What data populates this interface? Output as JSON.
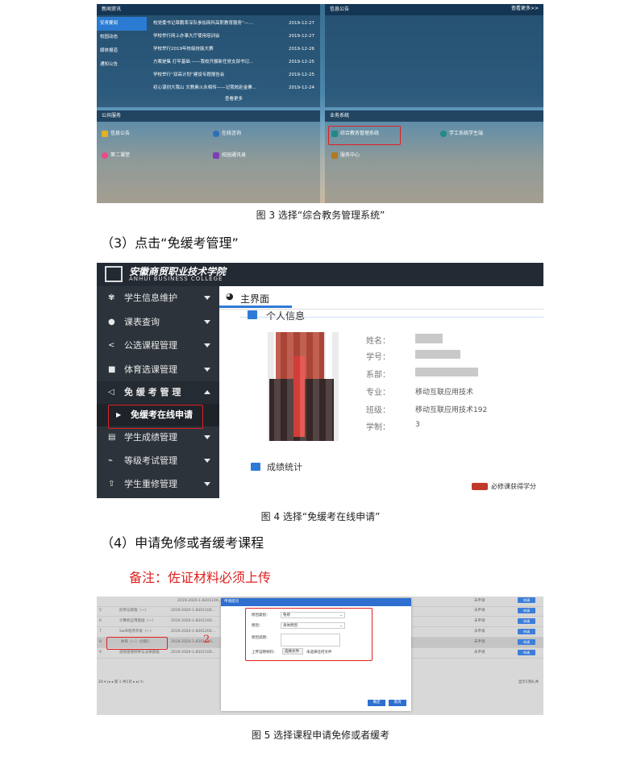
{
  "fig3": {
    "news_panel": {
      "title": "新闻资讯",
      "tabs": [
        "安青要闻",
        "校园动态",
        "媒体报道",
        "通知公告"
      ],
      "items": [
        {
          "title": "校党委书记章鹏率深队参加商科高职教育服务“—...",
          "date": "2019-12-27"
        },
        {
          "title": "学校举行网上办事大厅使用培训会",
          "date": "2019-12-27"
        },
        {
          "title": "学校举行2019年校级技能大赛",
          "date": "2019-12-26"
        },
        {
          "title": "方案是集 打牢基础 ——我校开展新任党支部书记...",
          "date": "2019-12-25"
        },
        {
          "title": "学校举行“双高计划”建设专题报告会",
          "date": "2019-12-25"
        },
        {
          "title": "初心谋创大我山 文教素火永相传——记我校赴金寨...",
          "date": "2019-12-24"
        }
      ],
      "more": "查看更多"
    },
    "info_panel": {
      "title": "信息公告",
      "more": "查看更多>>"
    },
    "public_panel": {
      "title": "公共服务",
      "items": [
        "信息公告",
        "在线咨询",
        "第二课堂",
        "校园通讯录"
      ]
    },
    "business_panel": {
      "title": "业务系统",
      "items": [
        "综合教务管理系统",
        "学工系统学生端",
        "服务中心"
      ]
    },
    "caption": "图 3  选择“综合教务管理系统”"
  },
  "step3": "（3）点击“免缓考管理”",
  "fig4": {
    "school_name": "安徽商贸职业技术学院",
    "school_name_en": "ANHUI BUSINESS COLLEGE",
    "menu": [
      {
        "label": "学生信息维护",
        "icon": "✾"
      },
      {
        "label": "课表查询",
        "icon": "●"
      },
      {
        "label": "公选课程管理",
        "icon": "<"
      },
      {
        "label": "体育选课管理",
        "icon": "■"
      },
      {
        "label": "免 缓 考 管 理",
        "icon": "◁"
      },
      {
        "label": "学生成绩管理",
        "icon": "▤"
      },
      {
        "label": "等级考试管理",
        "icon": "⌁"
      },
      {
        "label": "学生重修管理",
        "icon": "⇧"
      }
    ],
    "submenu": "免缓考在线申请",
    "tab": "主界面",
    "section_title": "个人信息",
    "fields": [
      {
        "label": "姓名：",
        "value": ""
      },
      {
        "label": "学号：",
        "value": ""
      },
      {
        "label": "系部：",
        "value": ""
      },
      {
        "label": "专业：",
        "value": "移动互联应用技术"
      },
      {
        "label": "班级：",
        "value": "移动互联应用技术192"
      },
      {
        "label": "学制：",
        "value": "3"
      }
    ],
    "grades_title": "成绩统计",
    "legend": "必修课获得学分",
    "caption": "图 4  选择“免缓考在线申请”"
  },
  "step4": "（4）申请免修或者缓考课程",
  "note": "备注：佐证材料必须上传",
  "fig5": {
    "rows": [
      {
        "num": "",
        "name": "",
        "code": "2019-2020-1-8201100...",
        "status": "未申请",
        "btn": "申请"
      },
      {
        "num": "5",
        "name": "形势与政策（一）",
        "code": "2019-2020-1-8201100...",
        "status": "未申请",
        "btn": "申请"
      },
      {
        "num": "6",
        "name": "计算机应用基础（一）",
        "code": "2019-2020-1-8201100...",
        "status": "未申请",
        "btn": "申请"
      },
      {
        "num": "7",
        "name": "Swift程序开发（一）",
        "code": "2019-2020-1-8201204...",
        "status": "未申请",
        "btn": "申请"
      },
      {
        "num": "8",
        "name": "体育（一）(创新)",
        "code": "2019-2020-1-8201100...",
        "status": "未申请",
        "btn": "申请"
      },
      {
        "num": "9",
        "name": "思想道德修养与法律基础",
        "code": "2019-2020-1-8201100...",
        "status": "未申请",
        "btn": "申请"
      }
    ],
    "pager": "20 ▾  |◂  ◂ 第 1  共1页  ▸  ▸|  ↻",
    "pager_right": "显示1到6,共",
    "dialog": {
      "title": "申请提问",
      "type_label": "原因类别：",
      "type_value": "免修",
      "reason_label": "原因：",
      "reason_value": "身体原因",
      "desc_label": "原因说明：",
      "upload_label": "上传证明材料：",
      "choose_file": "选择文件",
      "no_file": "未选择任何文件",
      "ok": "确定",
      "cancel": "取消"
    },
    "annotation": "2",
    "caption": "图 5  选择课程申请免修或者缓考"
  }
}
